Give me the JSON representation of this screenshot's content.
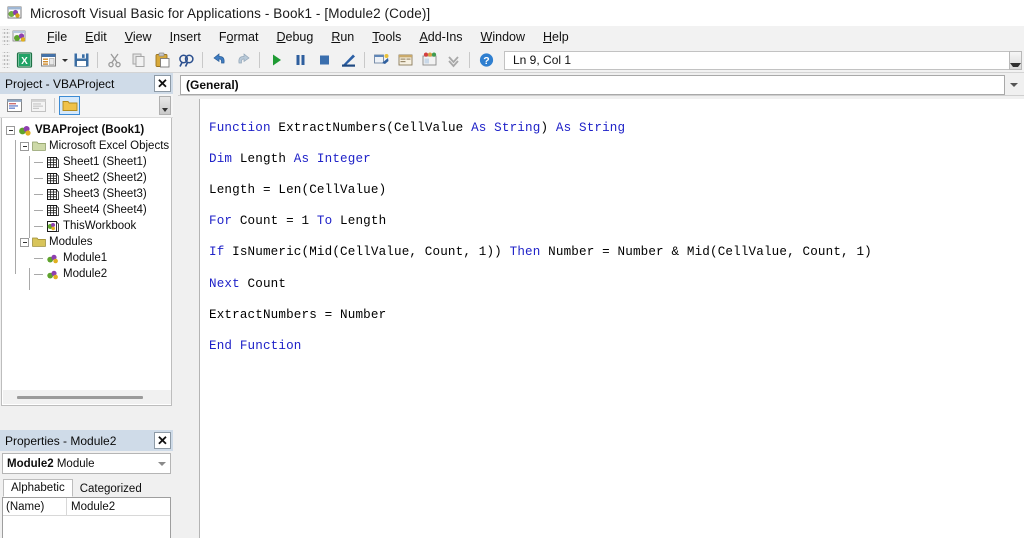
{
  "window": {
    "title": "Microsoft Visual Basic for Applications - Book1 - [Module2 (Code)]",
    "icon": "vba-window-icon"
  },
  "menubar": {
    "items": [
      {
        "label": "File",
        "accel": "F"
      },
      {
        "label": "Edit",
        "accel": "E"
      },
      {
        "label": "View",
        "accel": "V"
      },
      {
        "label": "Insert",
        "accel": "I"
      },
      {
        "label": "Format",
        "accel": "o"
      },
      {
        "label": "Debug",
        "accel": "D"
      },
      {
        "label": "Run",
        "accel": "R"
      },
      {
        "label": "Tools",
        "accel": "T"
      },
      {
        "label": "Add-Ins",
        "accel": "A"
      },
      {
        "label": "Window",
        "accel": "W"
      },
      {
        "label": "Help",
        "accel": "H"
      }
    ]
  },
  "toolbar": {
    "buttons": [
      {
        "name": "view-excel-icon",
        "enabled": true
      },
      {
        "name": "insert-userform-icon",
        "enabled": true
      },
      {
        "name": "save-icon",
        "enabled": true
      },
      {
        "name": "cut-icon",
        "enabled": false
      },
      {
        "name": "copy-icon",
        "enabled": false
      },
      {
        "name": "paste-icon",
        "enabled": true
      },
      {
        "name": "find-icon",
        "enabled": true
      },
      {
        "name": "undo-icon",
        "enabled": true
      },
      {
        "name": "redo-icon",
        "enabled": true
      },
      {
        "name": "run-icon",
        "enabled": true
      },
      {
        "name": "break-icon",
        "enabled": true
      },
      {
        "name": "reset-icon",
        "enabled": true
      },
      {
        "name": "design-mode-icon",
        "enabled": true
      },
      {
        "name": "project-explorer-icon",
        "enabled": true
      },
      {
        "name": "properties-window-icon",
        "enabled": true
      },
      {
        "name": "object-browser-icon",
        "enabled": true
      },
      {
        "name": "toolbox-icon",
        "enabled": false
      },
      {
        "name": "help-icon",
        "enabled": true
      }
    ],
    "position_indicator": "Ln 9, Col 1"
  },
  "project_panel": {
    "caption": "Project - VBAProject",
    "close_label": "✕",
    "toolbar": [
      {
        "name": "view-code-icon",
        "active": false
      },
      {
        "name": "view-object-icon",
        "active": false
      },
      {
        "name": "toggle-folders-icon",
        "active": true
      }
    ],
    "tree": [
      {
        "label": "VBAProject (Book1)",
        "icon": "vbaproject-icon",
        "depth": 0,
        "expander": "minus",
        "bold": true
      },
      {
        "label": "Microsoft Excel Objects",
        "icon": "folder-icon",
        "depth": 1,
        "expander": "minus",
        "bold": false
      },
      {
        "label": "Sheet1 (Sheet1)",
        "icon": "sheet-icon",
        "depth": 2,
        "expander": "stub",
        "bold": false
      },
      {
        "label": "Sheet2 (Sheet2)",
        "icon": "sheet-icon",
        "depth": 2,
        "expander": "stub",
        "bold": false
      },
      {
        "label": "Sheet3 (Sheet3)",
        "icon": "sheet-icon",
        "depth": 2,
        "expander": "stub",
        "bold": false
      },
      {
        "label": "Sheet4 (Sheet4)",
        "icon": "sheet-icon",
        "depth": 2,
        "expander": "stub",
        "bold": false
      },
      {
        "label": "ThisWorkbook",
        "icon": "thisworkbook-icon",
        "depth": 2,
        "expander": "stub",
        "bold": false
      },
      {
        "label": "Modules",
        "icon": "folder-icon",
        "depth": 1,
        "expander": "minus",
        "bold": false
      },
      {
        "label": "Module1",
        "icon": "module-icon",
        "depth": 2,
        "expander": "stub",
        "bold": false
      },
      {
        "label": "Module2",
        "icon": "module-icon",
        "depth": 2,
        "expander": "stub",
        "bold": false
      }
    ]
  },
  "properties_panel": {
    "caption": "Properties - Module2",
    "close_label": "✕",
    "selected_object": "Module2",
    "selected_object_type": "Module",
    "tabs": [
      {
        "label": "Alphabetic",
        "selected": true
      },
      {
        "label": "Categorized",
        "selected": false
      }
    ],
    "rows": [
      {
        "name": "(Name)",
        "value": "Module2"
      }
    ]
  },
  "code_window": {
    "object_dropdown": "(General)",
    "procedure_dropdown": "",
    "lines": [
      [
        {
          "t": "Function ",
          "k": true
        },
        {
          "t": "ExtractNumbers(CellValue ",
          "k": false
        },
        {
          "t": "As String",
          "k": true
        },
        {
          "t": ") ",
          "k": false
        },
        {
          "t": "As String",
          "k": true
        }
      ],
      [
        {
          "t": "Dim ",
          "k": true
        },
        {
          "t": "Length ",
          "k": false
        },
        {
          "t": "As Integer",
          "k": true
        }
      ],
      [
        {
          "t": "Length = Len(CellValue)",
          "k": false
        }
      ],
      [
        {
          "t": "For ",
          "k": true
        },
        {
          "t": "Count = 1 ",
          "k": false
        },
        {
          "t": "To ",
          "k": true
        },
        {
          "t": "Length",
          "k": false
        }
      ],
      [
        {
          "t": "If ",
          "k": true
        },
        {
          "t": "IsNumeric(Mid(CellValue, Count, 1)) ",
          "k": false
        },
        {
          "t": "Then ",
          "k": true
        },
        {
          "t": "Number = Number & Mid(CellValue, Count, 1)",
          "k": false
        }
      ],
      [
        {
          "t": "Next ",
          "k": true
        },
        {
          "t": "Count",
          "k": false
        }
      ],
      [
        {
          "t": "ExtractNumbers = Number",
          "k": false
        }
      ],
      [
        {
          "t": "End Function",
          "k": true
        }
      ]
    ]
  },
  "colors": {
    "keyword": "#1f22c8",
    "code_text": "#000000",
    "code_background": "#ffffff",
    "panel_caption": "#cfdbe8",
    "toolbar_background": "#f2f2f2",
    "window_background": "#f0f0f0"
  }
}
